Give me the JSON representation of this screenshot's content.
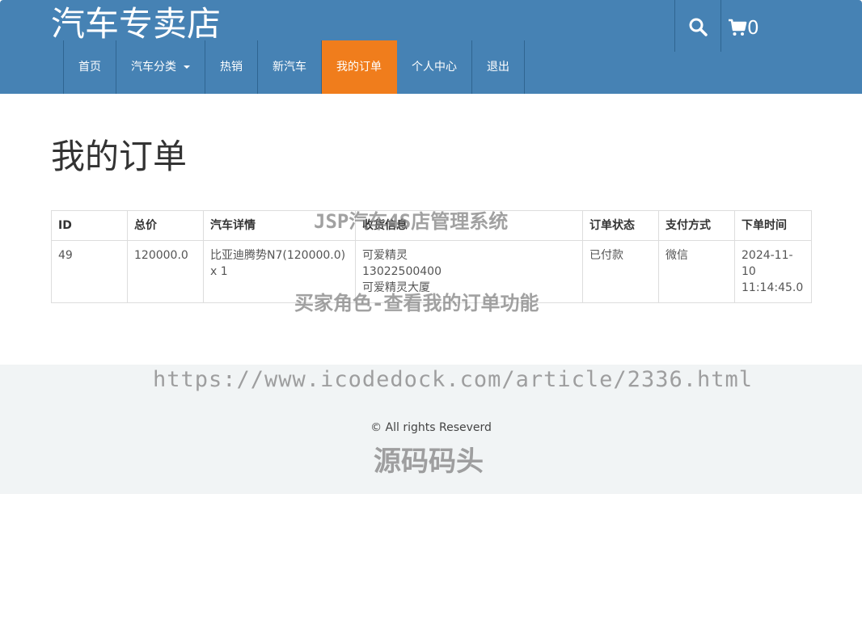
{
  "header": {
    "brand": "汽车专卖店",
    "cart_count": "0"
  },
  "nav": {
    "items": [
      {
        "label": "首页",
        "active": false
      },
      {
        "label": "汽车分类",
        "active": false,
        "dropdown": true
      },
      {
        "label": "热销",
        "active": false
      },
      {
        "label": "新汽车",
        "active": false
      },
      {
        "label": "我的订单",
        "active": true
      },
      {
        "label": "个人中心",
        "active": false
      },
      {
        "label": "退出",
        "active": false
      }
    ]
  },
  "icons": {
    "search": "search-icon",
    "cart": "cart-icon",
    "dropdown": "caret-down-icon"
  },
  "colors": {
    "header_bg": "#4682b4",
    "active_nav": "#f07d1c",
    "paid_status": "#c9302c",
    "footer_bg": "#f1f4f5"
  },
  "main": {
    "title": "我的订单",
    "table": {
      "headers": [
        "ID",
        "总价",
        "汽车详情",
        "收货信息",
        "订单状态",
        "支付方式",
        "下单时间"
      ],
      "rows": [
        {
          "id": "49",
          "total": "120000.0",
          "car_detail": "比亚迪腾势N7(120000.0) x 1",
          "shipping": [
            "可爱精灵",
            "13022500400",
            "可爱精灵大厦"
          ],
          "status": "已付款",
          "payment": "微信",
          "time": "2024-11-10 11:14:45.0"
        }
      ]
    }
  },
  "footer": {
    "copyright": "© All rights Reseverd"
  },
  "watermarks": {
    "line1": "JSP汽车4S店管理系统",
    "line2": "买家角色-查看我的订单功能",
    "line3": "https://www.icodedock.com/article/2336.html",
    "line4": "源码码头"
  }
}
